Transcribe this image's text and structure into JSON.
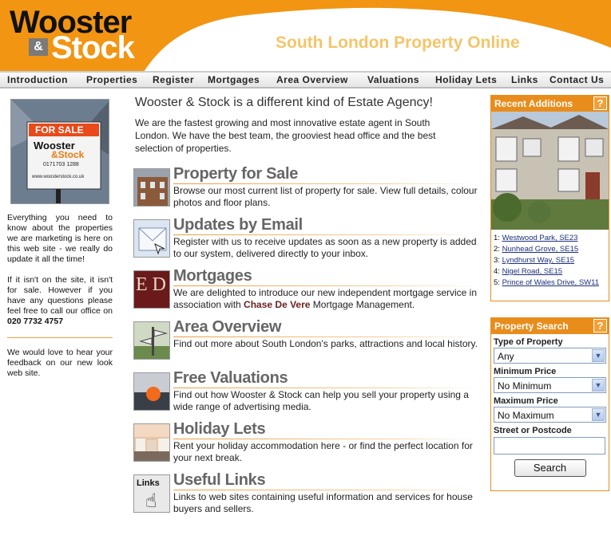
{
  "header": {
    "logo_top": "Wooster",
    "logo_amp": "&",
    "logo_bottom": "Stock",
    "tagline": "South London Property Online",
    "brand_orange": "#f29512"
  },
  "nav": {
    "items": [
      "Introduction",
      "Properties",
      "Register",
      "Mortgages",
      "Area Overview",
      "Valuations",
      "Holiday Lets",
      "Links",
      "Contact Us"
    ]
  },
  "left": {
    "sign": {
      "for_sale": "FOR SALE",
      "brand1": "Wooster",
      "brand2": "&Stock",
      "phone": "0171703 1288",
      "web": "www.woosterstock.co.uk"
    },
    "para1": "Everything you need to know about the properties we are marketing is here on this web site - we really do update it all the time!",
    "para2": "If it isn't on the site, it isn't for sale. However if you have any questions please feel free to call our office on",
    "phone": "020 7732 4757",
    "para3": "We would love to hear your feedback on our new look web site."
  },
  "main": {
    "title": "Wooster & Stock is a different kind of Estate Agency!",
    "intro": "We are the fastest growing and most innovative estate agent in South London. We have the best team, the grooviest head office and the best selection of properties.",
    "sections": [
      {
        "title": "Property for Sale",
        "text": "Browse our most current list of property for sale. View full details, colour photos and floor plans."
      },
      {
        "title": "Updates by Email",
        "text": "Register with us to receive updates as soon as a new property is added to our system, delivered directly to your inbox."
      },
      {
        "title": "Mortgages",
        "text_before": "We are delighted to introduce our new independent mortgage service in association with ",
        "text_bold": "Chase De Vere",
        "text_after": " Mortgage Management."
      },
      {
        "title": "Area Overview",
        "text": "Find out more about South London's parks, attractions and local history."
      },
      {
        "title": "Free Valuations",
        "text": "Find out how Wooster & Stock can help you sell your property using a wide range of advertising media."
      },
      {
        "title": "Holiday Lets",
        "text": "Rent your holiday accommodation here - or find the perfect location for your next break."
      },
      {
        "title": "Useful Links",
        "text": "Links to web sites containing useful information and services for house buyers and sellers."
      }
    ],
    "thumb_text_mortgage": "E D",
    "thumb_text_links": "Links"
  },
  "recent": {
    "title": "Recent Additions",
    "help": "?",
    "items": [
      {
        "num": "1:",
        "label": "Westwood Park, SE23"
      },
      {
        "num": "2:",
        "label": "Nunhead Grove, SE15"
      },
      {
        "num": "3:",
        "label": "Lyndhurst Way, SE15"
      },
      {
        "num": "4:",
        "label": "Nigel Road, SE15"
      },
      {
        "num": "5:",
        "label": "Prince of Wales Drive, SW11"
      }
    ]
  },
  "search": {
    "title": "Property Search",
    "help": "?",
    "type_label": "Type of Property",
    "type_value": "Any",
    "min_label": "Minimum Price",
    "min_value": "No Minimum",
    "max_label": "Maximum Price",
    "max_value": "No Maximum",
    "postcode_label": "Street or Postcode",
    "postcode_value": "",
    "button": "Search"
  }
}
